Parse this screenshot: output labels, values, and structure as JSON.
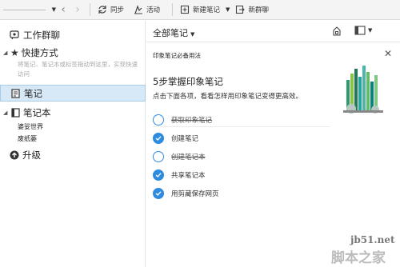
{
  "toolbar": {
    "sync": "同步",
    "activity": "活动",
    "new_note": "新建笔记",
    "new_chat": "新群聊"
  },
  "sidebar": {
    "group_chat": "工作群聊",
    "shortcuts": "快捷方式",
    "shortcuts_hint": "将笔记、笔记本或标签拖动到这里，实现快速访问",
    "notes": "笔记",
    "notebooks": "笔记本",
    "notebook_items": [
      "婆娑世界",
      "废纸篓"
    ],
    "upgrade": "升级"
  },
  "main": {
    "title": "全部笔记",
    "card_title": "印象笔记必备用法",
    "card_heading": "5步掌握印象笔记",
    "card_subtitle": "点击下面各项，看看怎样用印象笔记变得更高效。",
    "tasks": [
      {
        "label": "获取印象笔记",
        "done": false,
        "strike": true
      },
      {
        "label": "创建笔记",
        "done": true,
        "strike": false
      },
      {
        "label": "创建笔记本",
        "done": false,
        "strike": true
      },
      {
        "label": "共享笔记本",
        "done": true,
        "strike": false
      },
      {
        "label": "用剪藏保存网页",
        "done": true,
        "strike": false
      }
    ]
  },
  "watermark": {
    "site": "jb51.net",
    "name": "脚本之家"
  },
  "colors": {
    "accent": "#2d8be0",
    "selection": "#d7e8f7"
  }
}
